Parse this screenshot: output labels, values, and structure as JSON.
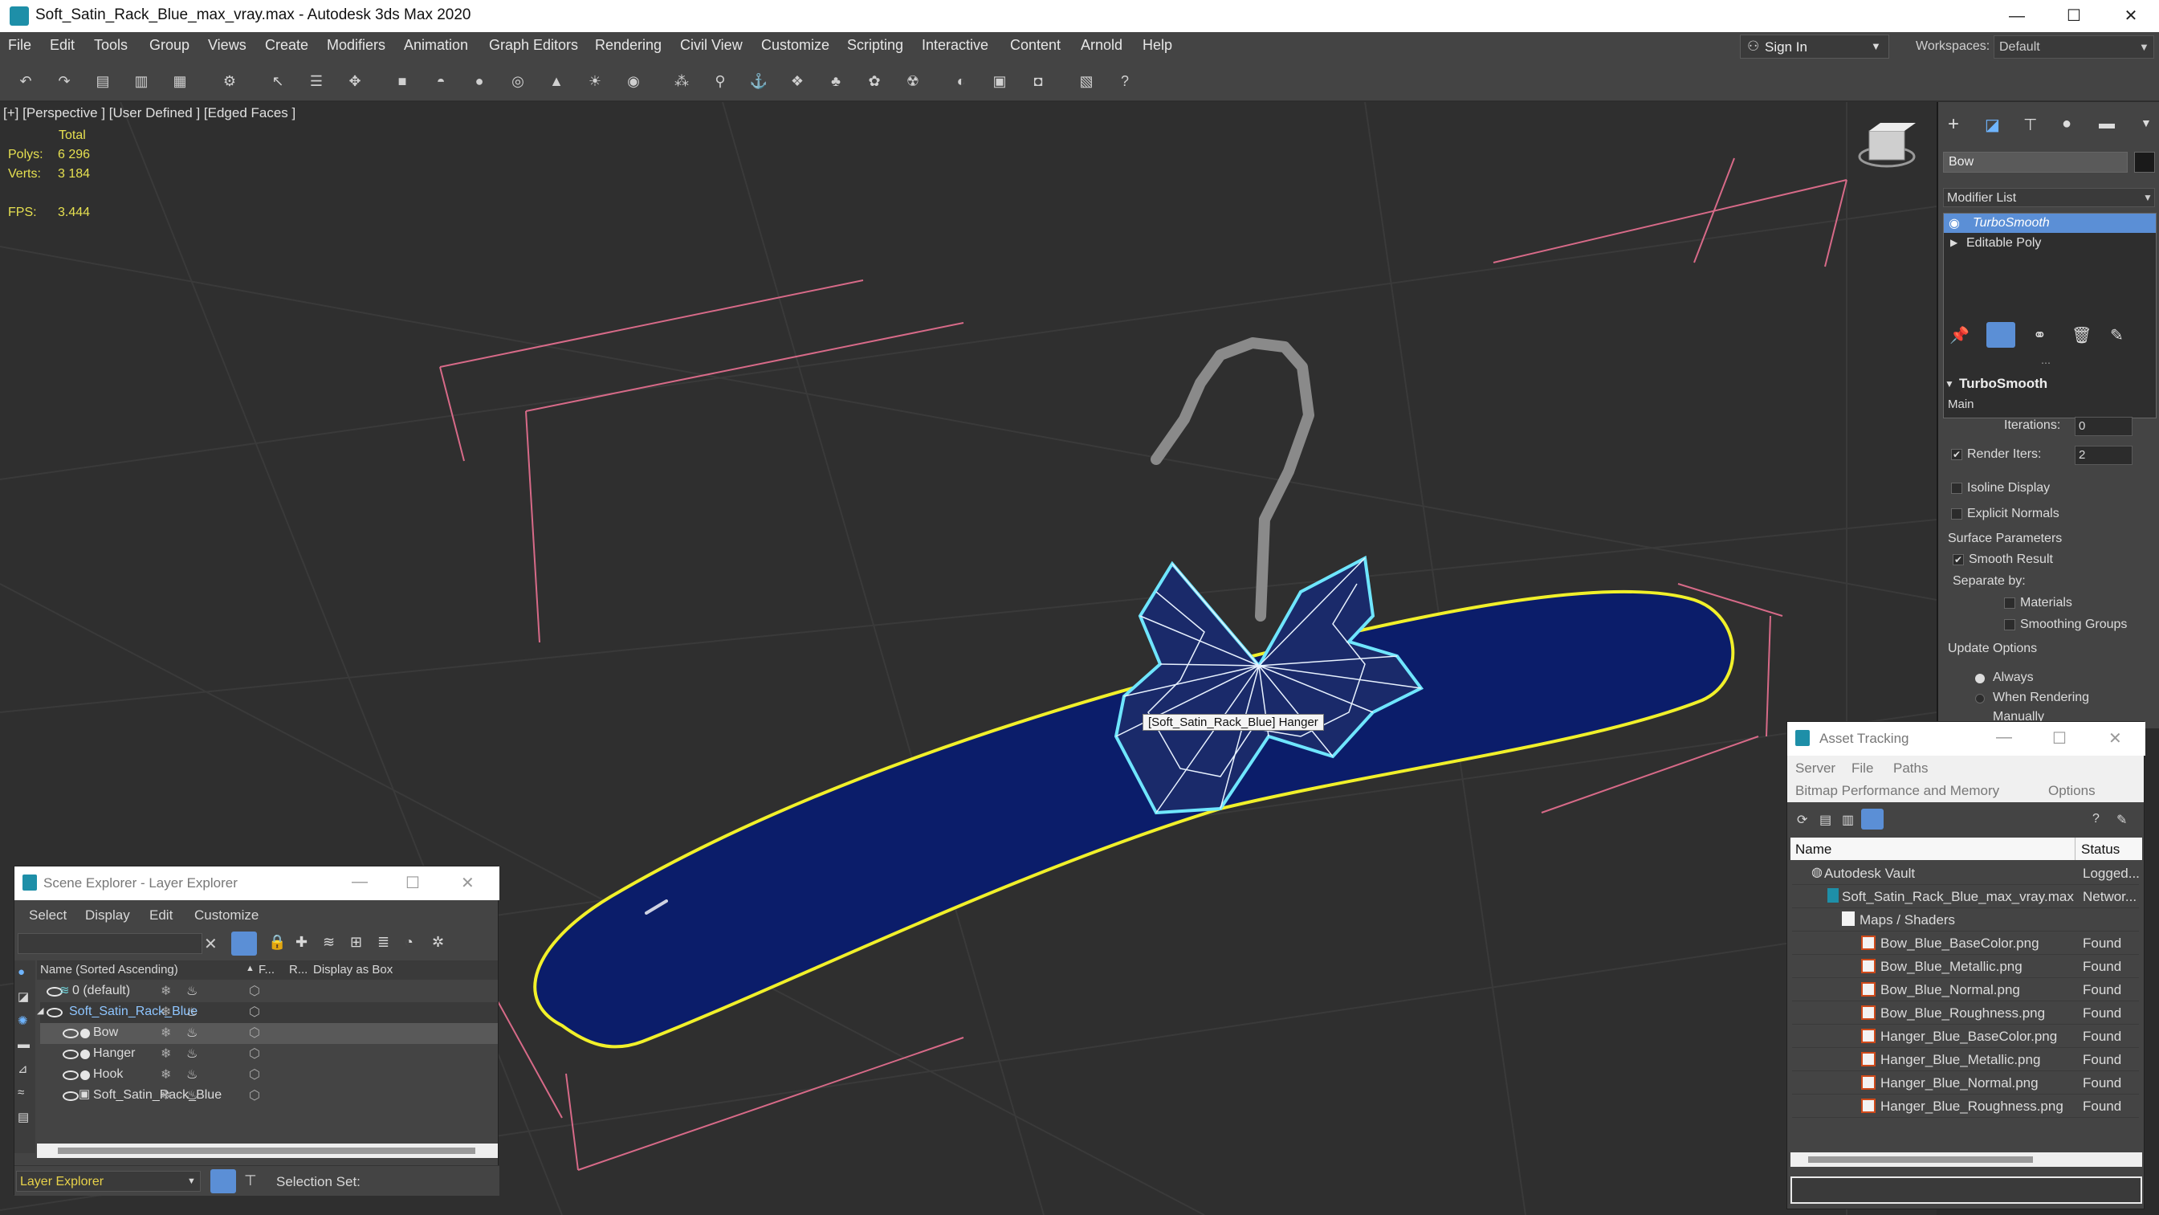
{
  "window": {
    "title": "Soft_Satin_Rack_Blue_max_vray.max - Autodesk 3ds Max 2020",
    "min": "—",
    "max": "☐",
    "close": "✕"
  },
  "menu": [
    "File",
    "Edit",
    "Tools",
    "Group",
    "Views",
    "Create",
    "Modifiers",
    "Animation",
    "Graph Editors",
    "Rendering",
    "Civil View",
    "Customize",
    "Scripting",
    "Interactive",
    "Content",
    "Arnold",
    "Help"
  ],
  "signin": {
    "label": "Sign In",
    "caret": "▼"
  },
  "workspaces": {
    "label": "Workspaces:",
    "value": "Default",
    "caret": "▼"
  },
  "viewport": {
    "label": "[+] [Perspective ] [User Defined ] [Edged Faces ]",
    "stats": {
      "total_label": "Total",
      "polys_label": "Polys:",
      "polys_value": "6 296",
      "verts_label": "Verts:",
      "verts_value": "3 184",
      "fps_label": "FPS:",
      "fps_value": "3.444"
    },
    "tooltip": "[Soft_Satin_Rack_Blue] Hanger",
    "colors": {
      "hanger": "#0b1d6a",
      "selection": "#f1f02a",
      "bow_outline": "#6fe6ff",
      "bounds": "#d76a88"
    }
  },
  "command_panel": {
    "name_field": "Bow",
    "modifier_list": "Modifier List",
    "stack": [
      "TurboSmooth",
      "Editable Poly"
    ],
    "rollout_title": "TurboSmooth",
    "main_label": "Main",
    "iterations_label": "Iterations:",
    "iterations_value": "0",
    "render_iters_label": "Render Iters:",
    "render_iters_value": "2",
    "isoline": "Isoline Display",
    "explicit_normals": "Explicit Normals",
    "surface_params": "Surface Parameters",
    "smooth_result": "Smooth Result",
    "separate_by": "Separate by:",
    "materials": "Materials",
    "smoothing_groups": "Smoothing Groups",
    "update_options": "Update Options",
    "always": "Always",
    "when_rendering": "When Rendering",
    "manually": "Manually"
  },
  "scene_explorer": {
    "title": "Scene Explorer - Layer Explorer",
    "menu": [
      "Select",
      "Display",
      "Edit",
      "Customize"
    ],
    "columns": {
      "name": "Name (Sorted Ascending)",
      "sort": "▲",
      "f": "F...",
      "r": "R...",
      "display": "Display as Box"
    },
    "rows": [
      {
        "label": "0 (default)",
        "indent": 0
      },
      {
        "label": "Soft_Satin_Rack_Blue",
        "indent": 0
      },
      {
        "label": "Bow",
        "indent": 1
      },
      {
        "label": "Hanger",
        "indent": 1
      },
      {
        "label": "Hook",
        "indent": 1
      },
      {
        "label": "Soft_Satin_Rack_Blue",
        "indent": 1
      }
    ],
    "footer_dropdown": "Layer Explorer",
    "selection_set": "Selection Set:"
  },
  "asset_tracking": {
    "title": "Asset Tracking",
    "menu1": [
      "Server",
      "File",
      "Paths"
    ],
    "menu2": [
      "Bitmap Performance and Memory",
      "Options"
    ],
    "columns": {
      "name": "Name",
      "status": "Status"
    },
    "rows": [
      {
        "name": "Autodesk Vault",
        "status": "Logged..."
      },
      {
        "name": "Soft_Satin_Rack_Blue_max_vray.max",
        "status": "Networ..."
      },
      {
        "name": "Maps / Shaders",
        "status": ""
      },
      {
        "name": "Bow_Blue_BaseColor.png",
        "status": "Found"
      },
      {
        "name": "Bow_Blue_Metallic.png",
        "status": "Found"
      },
      {
        "name": "Bow_Blue_Normal.png",
        "status": "Found"
      },
      {
        "name": "Bow_Blue_Roughness.png",
        "status": "Found"
      },
      {
        "name": "Hanger_Blue_BaseColor.png",
        "status": "Found"
      },
      {
        "name": "Hanger_Blue_Metallic.png",
        "status": "Found"
      },
      {
        "name": "Hanger_Blue_Normal.png",
        "status": "Found"
      },
      {
        "name": "Hanger_Blue_Roughness.png",
        "status": "Found"
      }
    ]
  },
  "accent": "#5b8fd6"
}
